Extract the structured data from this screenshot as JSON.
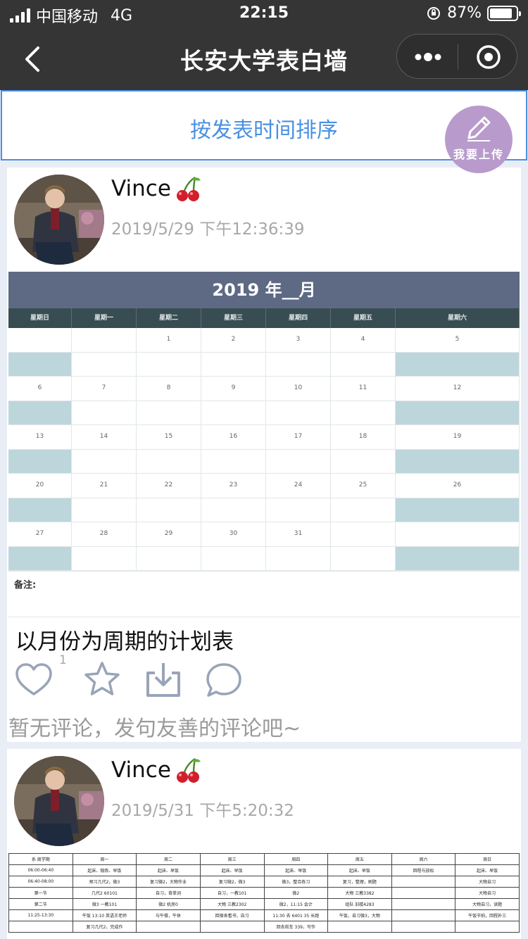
{
  "status": {
    "carrier": "中国移动",
    "network": "4G",
    "time": "22:15",
    "battery": "87%",
    "battery_level": 0.87
  },
  "nav": {
    "title": "长安大学表白墙"
  },
  "sort": {
    "label": "按发表时间排序"
  },
  "upload": {
    "label": "我要上传"
  },
  "posts": [
    {
      "username": "Vince",
      "badge": "cherry-icon",
      "timestamp": "2019/5/29 下午12:36:39",
      "caption": "以月份为周期的计划表",
      "like_count": "1",
      "comment_hint": "暂无评论，发句友善的评论吧~",
      "calendar": {
        "title": "2019 年__月",
        "weekdays": [
          "星期日",
          "星期一",
          "星期二",
          "星期三",
          "星期四",
          "星期五",
          "星期六"
        ],
        "rows": [
          [
            "",
            "",
            "1",
            "2",
            "3",
            "4",
            "5"
          ],
          [
            "6",
            "7",
            "8",
            "9",
            "10",
            "11",
            "12"
          ],
          [
            "13",
            "14",
            "15",
            "16",
            "17",
            "18",
            "19"
          ],
          [
            "20",
            "21",
            "22",
            "23",
            "24",
            "25",
            "26"
          ],
          [
            "27",
            "28",
            "29",
            "30",
            "31",
            "",
            ""
          ]
        ],
        "note_label": "备注:"
      }
    },
    {
      "username": "Vince",
      "badge": "cherry-icon",
      "timestamp": "2019/5/31 下午5:20:32",
      "timetable": {
        "header": [
          "系 周学期",
          "周一",
          "周二",
          "周三",
          "周四",
          "周五",
          "周六",
          "周日"
        ],
        "rows": [
          [
            "06:00-06:40",
            "起床、锻炼、早饭",
            "起床、早饭",
            "起床、早饭",
            "起床、早饭",
            "起床、早饭",
            "回程与放松",
            "起床、早饭"
          ],
          [
            "06:40-08:00",
            "预习几代2，微3",
            "复习微2，大物作业",
            "复习微2，微3",
            "微3，整合练习",
            "复习，整理，刷题",
            "",
            "大物自习"
          ],
          [
            "第一节",
            "几代2 60101",
            "自习，背单词",
            "自习，一教101",
            "微2",
            "大物 三教3382",
            "",
            "大物自习"
          ],
          [
            "第二节",
            "微3 一教101",
            "微2 机房0",
            "大物 三教2302",
            "微2，11:15 会计",
            "组队 旧楼4283",
            "",
            "大物自习，读题"
          ],
          [
            "11:25-13:30",
            "午饭 13:10 英语王老师",
            "与午餐，午休",
            "回宿舍看书，自习",
            "11:30 去 6401 35 长跑",
            "午饭，自习微3，大物",
            "",
            "午饭节拍，回程补三"
          ],
          [
            "",
            "复习几代2，完成作",
            "",
            "",
            "回去前车 339，写作",
            "",
            "",
            ""
          ]
        ]
      }
    }
  ]
}
